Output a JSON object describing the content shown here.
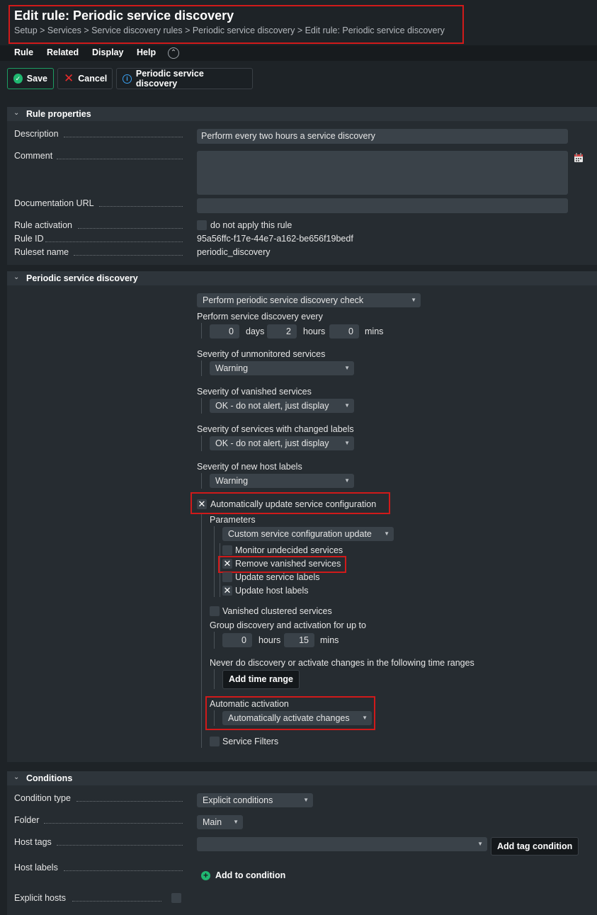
{
  "header": {
    "title": "Edit rule: Periodic service discovery",
    "breadcrumb": "Setup > Services > Service discovery rules > Periodic service discovery > Edit rule: Periodic service discovery"
  },
  "menu": [
    "Rule",
    "Related",
    "Display",
    "Help"
  ],
  "toolbar": {
    "save_label": "Save",
    "cancel_label": "Cancel",
    "discovery_label": "Periodic service discovery"
  },
  "rule_properties": {
    "title": "Rule properties",
    "description_label": "Description",
    "description_value": "Perform every two hours a service discovery",
    "comment_label": "Comment",
    "comment_value": "",
    "doc_url_label": "Documentation URL",
    "doc_url_value": "",
    "activation_label": "Rule activation",
    "activation_checkbox_label": "do not apply this rule",
    "rule_id_label": "Rule ID",
    "rule_id_value": "95a56ffc-f17e-44e7-a162-be656f19bedf",
    "ruleset_label": "Ruleset name",
    "ruleset_value": "periodic_discovery"
  },
  "periodic": {
    "title": "Periodic service discovery",
    "mode_select": "Perform periodic service discovery check",
    "interval_label": "Perform service discovery every",
    "days_value": "0",
    "days_unit": "days",
    "hours_value": "2",
    "hours_unit": "hours",
    "mins_value": "0",
    "mins_unit": "mins",
    "unmonitored_label": "Severity of unmonitored services",
    "unmonitored_value": "Warning",
    "vanished_label": "Severity of vanished services",
    "vanished_value": "OK - do not alert, just display",
    "changed_labels_label": "Severity of services with changed labels",
    "changed_labels_value": "OK - do not alert, just display",
    "new_host_labels_label": "Severity of new host labels",
    "new_host_labels_value": "Warning",
    "auto_update_label": "Automatically update service configuration",
    "parameters_label": "Parameters",
    "parameters_select": "Custom service configuration update",
    "monitor_undecided_label": "Monitor undecided services",
    "remove_vanished_label": "Remove vanished services",
    "update_service_labels_label": "Update service labels",
    "update_host_labels_label": "Update host labels",
    "vanished_clustered_label": "Vanished clustered services",
    "group_label": "Group discovery and activation for up to",
    "group_hours_value": "0",
    "group_hours_unit": "hours",
    "group_mins_value": "15",
    "group_mins_unit": "mins",
    "never_label": "Never do discovery or activate changes in the following time ranges",
    "add_time_range_label": "Add time range",
    "auto_activation_label": "Automatic activation",
    "auto_activation_select": "Automatically activate changes",
    "service_filters_label": "Service Filters"
  },
  "conditions": {
    "title": "Conditions",
    "type_label": "Condition type",
    "type_value": "Explicit conditions",
    "folder_label": "Folder",
    "folder_value": "Main",
    "host_tags_label": "Host tags",
    "host_tags_value": "",
    "add_tag_label": "Add tag condition",
    "host_labels_label": "Host labels",
    "add_to_condition_label": "Add to condition",
    "explicit_hosts_label": "Explicit hosts"
  }
}
